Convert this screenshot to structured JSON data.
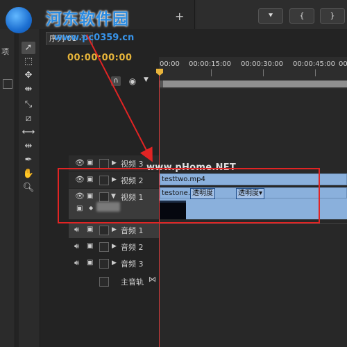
{
  "watermark": {
    "title": "河东软件园",
    "url": "www.pc0359.cn",
    "mid": "www.pHome.NET"
  },
  "top_bar": {
    "plus_label": "+",
    "buttons": [
      "⯆",
      "{",
      "}",
      "{"
    ]
  },
  "left_panel": {
    "label": "项"
  },
  "sequence": {
    "tab_label": "序列 01",
    "tab_close": "×",
    "timecode": "00:00:00:00"
  },
  "ruler": {
    "labels": [
      "00:00",
      "00:00:15:00",
      "00:00:30:00",
      "00:00:45:00",
      "00"
    ]
  },
  "tracks": {
    "video": [
      {
        "name": "视频 3"
      },
      {
        "name": "视频 2"
      },
      {
        "name": "视频 1",
        "expanded": true
      }
    ],
    "audio": [
      {
        "name": "音频 1"
      },
      {
        "name": "音频 2"
      },
      {
        "name": "音频 3"
      }
    ],
    "master": {
      "name": "主音轨"
    }
  },
  "clips": {
    "video2": {
      "name": "testtwo.mp4"
    },
    "video1": {
      "name": "testone.mp4",
      "effect1": "透明度",
      "effect2": "透明度▾"
    }
  },
  "icons": {
    "eye": "eye-icon",
    "camera": "film-icon",
    "speaker": "speaker-icon",
    "expand": "disclosure-triangle-icon"
  },
  "colors": {
    "playhead": "#d43b3b",
    "timecode": "#e6b43a",
    "clip": "#8ab0dc",
    "annotation": "#e12424"
  }
}
